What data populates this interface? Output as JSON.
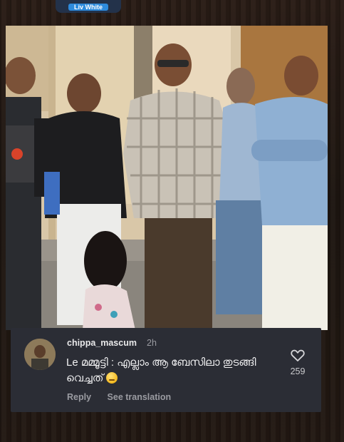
{
  "top_badge": {
    "label": "Liv White"
  },
  "photo": {
    "alt_subject": "group-photo"
  },
  "comment": {
    "username": "chippa_mascum",
    "time": "2h",
    "text": "Le മമ്മൂട്ടി : എല്ലാം ആ ബേസിലാ തുടങ്ങി വെച്ചത്",
    "reply_label": "Reply",
    "translate_label": "See translation",
    "like_count": "259",
    "icons": {
      "like": "heart-icon",
      "emoji": "face-emoji-icon"
    }
  },
  "colors": {
    "panel": "#2b2d35",
    "text": "#f2f2f3",
    "muted": "#9a9ba1"
  }
}
